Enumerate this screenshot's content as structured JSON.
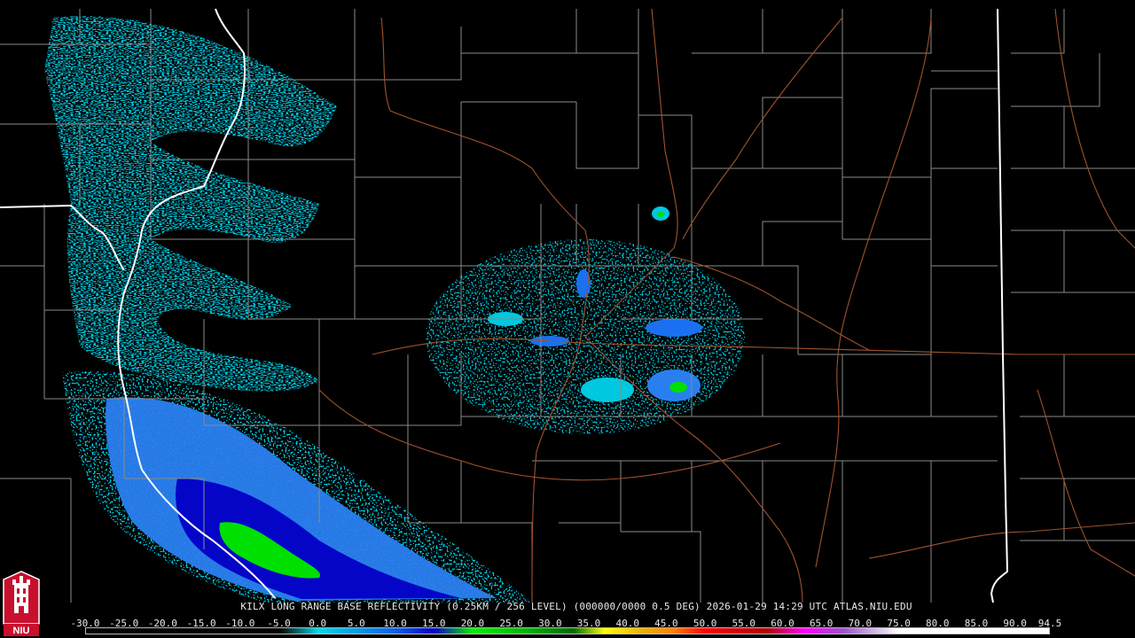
{
  "caption": "KILX LONG RANGE BASE REFLECTIVITY (0.25KM / 256 LEVEL) (000000/0000 0.5 DEG) 2026-01-29 14:29 UTC  ATLAS.NIU.EDU",
  "logo": {
    "text": "NIU",
    "icon": "niu-tower-logo",
    "colors": {
      "fill": "#c8102e",
      "tower": "#ffffff"
    }
  },
  "scale": {
    "unit_hint": "dBZ",
    "ticks": [
      "-30.0",
      "-25.0",
      "-20.0",
      "-15.0",
      "-10.0",
      "-5.0",
      "0.0",
      "5.0",
      "10.0",
      "15.0",
      "20.0",
      "25.0",
      "30.0",
      "35.0",
      "40.0",
      "45.0",
      "50.0",
      "55.0",
      "60.0",
      "65.0",
      "70.0",
      "75.0",
      "80.0",
      "85.0",
      "90.0",
      "94.5"
    ],
    "colors": [
      {
        "v": -30,
        "c": "#000000"
      },
      {
        "v": -5,
        "c": "#000000"
      },
      {
        "v": 0,
        "c": "#00d8e6"
      },
      {
        "v": 10,
        "c": "#0a60e8"
      },
      {
        "v": 15,
        "c": "#0000c8"
      },
      {
        "v": 20,
        "c": "#00f000"
      },
      {
        "v": 27,
        "c": "#00b400"
      },
      {
        "v": 33,
        "c": "#006a00"
      },
      {
        "v": 37,
        "c": "#ffff00"
      },
      {
        "v": 42,
        "c": "#e8b000"
      },
      {
        "v": 46,
        "c": "#ff8000"
      },
      {
        "v": 50,
        "c": "#ff0000"
      },
      {
        "v": 58,
        "c": "#b00000"
      },
      {
        "v": 63,
        "c": "#ff00ff"
      },
      {
        "v": 68,
        "c": "#9a55c8"
      },
      {
        "v": 75,
        "c": "#ffffff"
      },
      {
        "v": 94.5,
        "c": "#ffffff"
      }
    ]
  },
  "map": {
    "colors": {
      "county": "#8a8a8a",
      "state": "#ffffff",
      "highway": "#a0522d",
      "light_echo": "#00c8e0",
      "mid_echo": "#1a70f0",
      "heavy_echo": "#0000c8",
      "peak_echo": "#00e600"
    }
  }
}
